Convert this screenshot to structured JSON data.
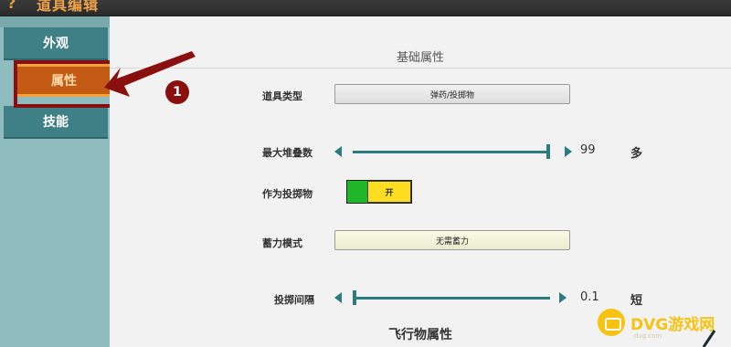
{
  "titlebar": {
    "icon_glyph": "?",
    "title": "道具编辑"
  },
  "sidebar": {
    "tabs": [
      {
        "label": "外观",
        "selected": false
      },
      {
        "label": "属性",
        "selected": true
      },
      {
        "label": "技能",
        "selected": false
      }
    ],
    "annotation_number": "1"
  },
  "main": {
    "section_basic": "基础属性",
    "item_type": {
      "label": "道具类型",
      "value": "弹药/投掷物"
    },
    "max_stack": {
      "label": "最大堆叠数",
      "value": "99",
      "unit": "多",
      "fraction": 1.0
    },
    "as_throwable": {
      "label": "作为投掷物",
      "state": "开"
    },
    "charge_mode": {
      "label": "蓄力模式",
      "value": "无需蓄力"
    },
    "throw_interval": {
      "label": "投掷间隔",
      "value": "0.1",
      "unit": "短",
      "fraction": 0.0
    },
    "section_flight": "飞行物属性"
  },
  "watermark": {
    "text": "DVG游戏网",
    "sub": "dvg.com"
  },
  "colors": {
    "accent": "#2b7c80",
    "selected_tab": "#c35b14",
    "annotation": "#8a0f0f",
    "toggle_on": "#21b52a",
    "toggle_knob": "#ffde21"
  },
  "icons": [
    "help-icon",
    "left-arrow-icon",
    "right-arrow-icon",
    "gamepad-icon"
  ]
}
